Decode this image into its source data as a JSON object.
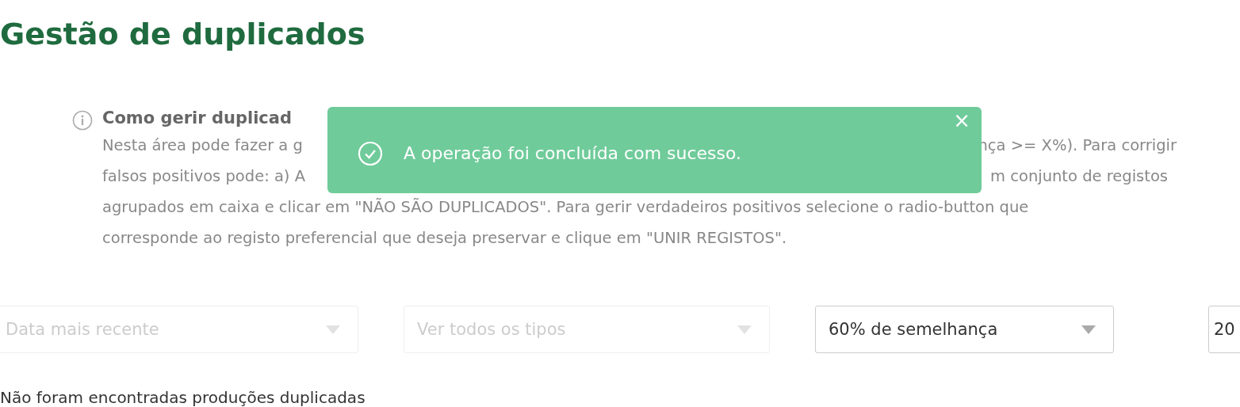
{
  "page_title": "Gestão de duplicados",
  "help": {
    "title": "Como gerir duplicad",
    "lines": [
      {
        "left": "Nesta área pode fazer a g",
        "right": "nça >= X%). Para corrigir"
      },
      {
        "left": "falsos positivos pode: a) A",
        "right": "m conjunto de registos"
      },
      {
        "left": "agrupados em caixa e clicar em \"NÃO SÃO DUPLICADOS\". Para gerir verdadeiros positivos selecione o radio-button que"
      },
      {
        "left": "corresponde ao registo preferencial que deseja preservar e clique em \"UNIR REGISTOS\"."
      }
    ]
  },
  "toast": {
    "message": "A operação foi concluída com sucesso.",
    "close": "×"
  },
  "filters": [
    {
      "value": "Data mais recente",
      "disabled": true
    },
    {
      "value": "Ver todos os tipos",
      "disabled": true
    },
    {
      "value": "60% de semelhança",
      "disabled": false
    },
    {
      "value": "20",
      "disabled": false
    }
  ],
  "empty_message": "Não foram encontradas produções duplicadas"
}
